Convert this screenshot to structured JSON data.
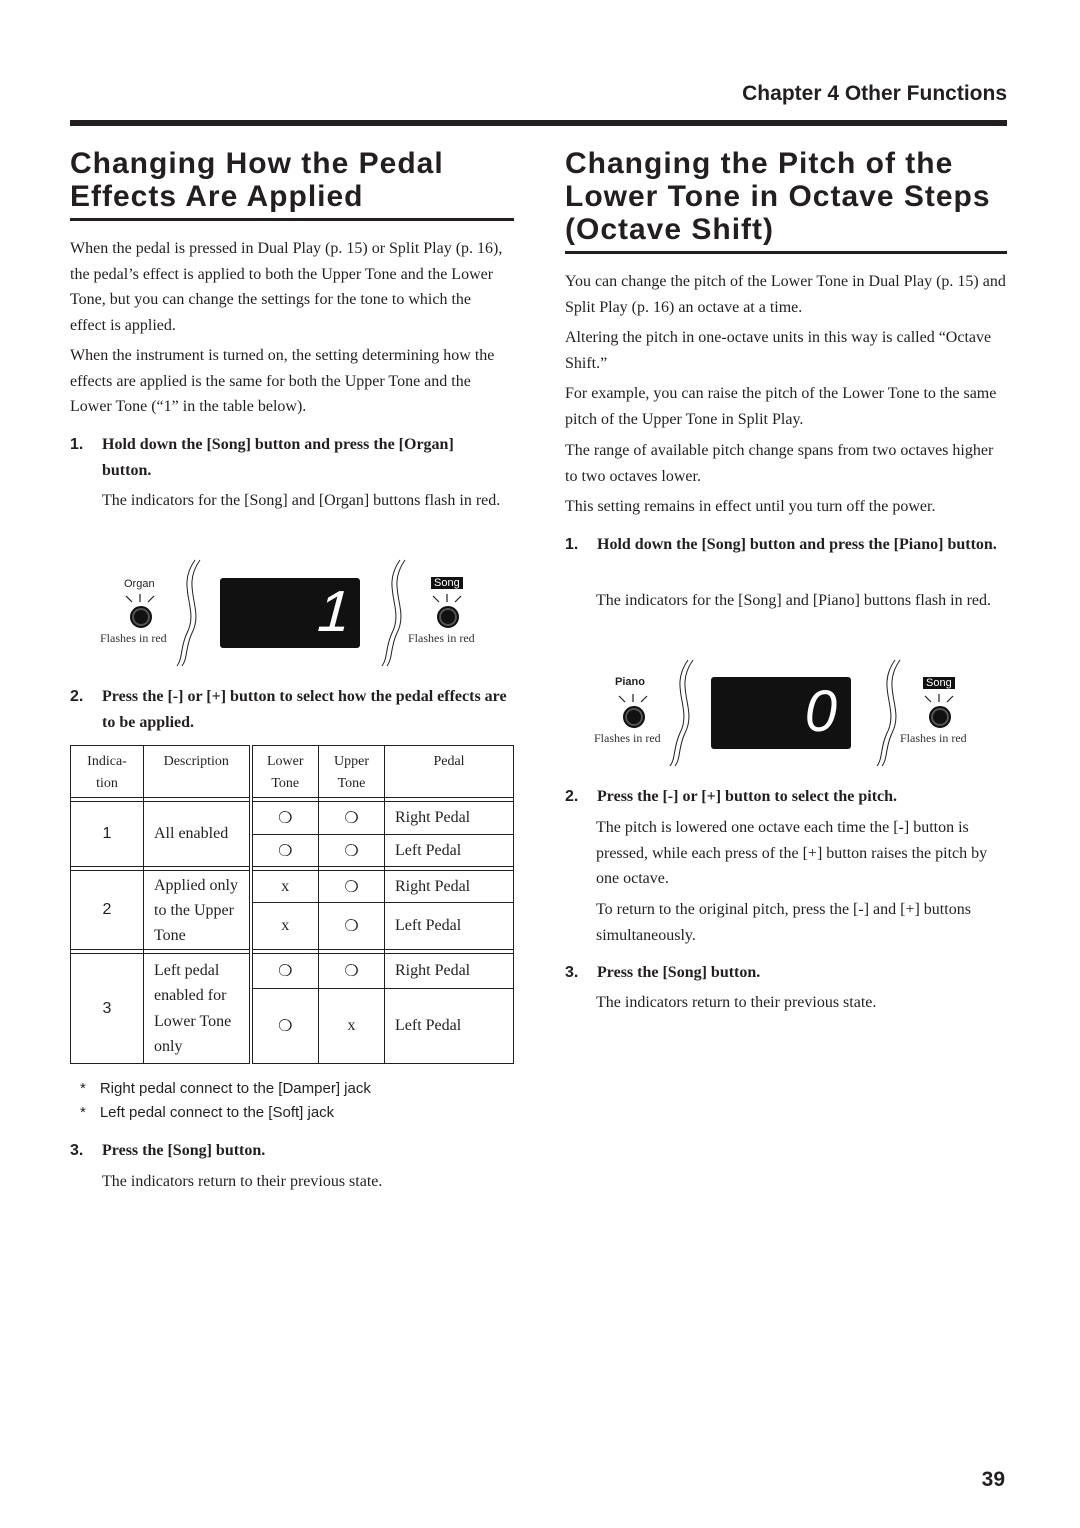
{
  "header": {
    "chapter": "Chapter 4 Other Functions"
  },
  "left": {
    "title_lines": [
      "Changing How the Pedal",
      "Effects Are Applied"
    ],
    "paragraphs": [
      "When the pedal is pressed in Dual Play (p. 15) or Split Play (p. 16), the pedal’s effect is applied to both the Upper Tone and the Lower Tone, but you can change the settings for the tone to which the effect is applied.",
      "When the instrument is turned on, the setting determining how the effects are applied is the same for both the Upper Tone and the Lower Tone (“1” in the table below)."
    ],
    "steps": [
      {
        "num": "1.",
        "heading": "Hold down the [Song] button and press the [Organ] button.",
        "text": "The indicators for the [Song] and [Organ] buttons flash in red."
      },
      {
        "num": "2.",
        "heading": "Press the [-] or [+] button to select how the pedal effects are to be applied.",
        "text": ""
      },
      {
        "num": "3.",
        "heading": "Press the [Song] button.",
        "text": "The indicators return to their previous state."
      }
    ],
    "diagram": {
      "left_button": "Organ",
      "right_button": "Song",
      "display_digit": "1",
      "left_caption": "Flashes in red",
      "right_caption": "Flashes in red"
    },
    "table": {
      "headers": [
        "Indica-\ntion",
        "Description",
        "Lower\nTone",
        "Upper\nTone",
        "Pedal"
      ],
      "groups": [
        {
          "indication": "1",
          "description": "All enabled",
          "rows": [
            [
              "❍",
              "❍",
              "Right Pedal"
            ],
            [
              "❍",
              "❍",
              "Left Pedal"
            ]
          ]
        },
        {
          "indication": "2",
          "description": "Applied only to the Upper Tone",
          "rows": [
            [
              "x",
              "❍",
              "Right Pedal"
            ],
            [
              "x",
              "❍",
              "Left Pedal"
            ]
          ]
        },
        {
          "indication": "3",
          "description": "Left pedal enabled for Lower Tone only",
          "rows": [
            [
              "❍",
              "❍",
              "Right Pedal"
            ],
            [
              "❍",
              "x",
              "Left Pedal"
            ]
          ]
        }
      ]
    },
    "footnotes": [
      "Right pedal connect to the [Damper] jack",
      "Left pedal connect to the [Soft] jack"
    ],
    "footnote_mark": "*"
  },
  "right": {
    "title_lines": [
      "Changing the Pitch of the",
      "Lower Tone in Octave Steps",
      "(Octave Shift)"
    ],
    "paragraphs": [
      "You can change the pitch of the Lower Tone in Dual Play (p. 15) and Split Play (p. 16) an octave at a time.",
      "Altering the pitch in one-octave units in this way is called “Octave Shift.”",
      "For example, you can raise the pitch of the Lower Tone to the same pitch of the Upper Tone in Split Play.",
      "The range of available pitch change spans from two octaves higher to two octaves lower.",
      "This setting remains in effect until you turn off the power."
    ],
    "steps": [
      {
        "num": "1.",
        "heading": "Hold down the [Song] button and press the [Piano] button.",
        "text": "The indicators for the [Song] and [Piano] buttons flash in red."
      },
      {
        "num": "2.",
        "heading": "Press the [-] or [+] button to select the pitch.",
        "text": "The pitch is lowered one octave each time the [-] button is pressed, while each press of the [+] button raises the pitch by one octave.",
        "text2": "To return to the original pitch, press the [-] and [+] buttons simultaneously."
      },
      {
        "num": "3.",
        "heading": "Press the [Song] button.",
        "text": "The indicators return to their previous state."
      }
    ],
    "diagram": {
      "left_button": "Piano",
      "right_button": "Song",
      "display_digit": "0",
      "left_caption": "Flashes in red",
      "right_caption": "Flashes in red"
    }
  },
  "page_number": "39"
}
